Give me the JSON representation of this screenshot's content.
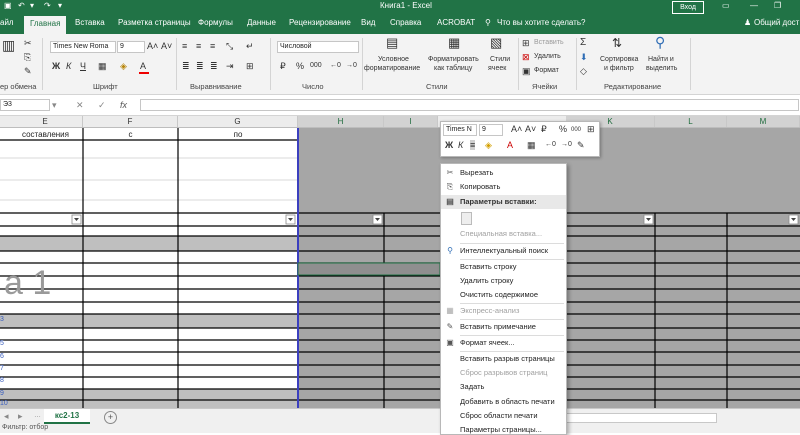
{
  "window": {
    "title": "Книга1  -  Excel",
    "signin_label": "Вход",
    "minimize_glyph": "—",
    "maximize_glyph": "❐"
  },
  "tabs": [
    {
      "label": "айл"
    },
    {
      "label": "Главная"
    },
    {
      "label": "Вставка"
    },
    {
      "label": "Разметка страницы"
    },
    {
      "label": "Формулы"
    },
    {
      "label": "Данные"
    },
    {
      "label": "Рецензирование"
    },
    {
      "label": "Вид"
    },
    {
      "label": "Справка"
    },
    {
      "label": "ACROBAT"
    }
  ],
  "tellme": "Что вы хотите сделать?",
  "share": "Общий дост",
  "ribbon": {
    "font_name": "Times New Roma",
    "font_size": "9",
    "number_format": "Числовой",
    "groups": {
      "clipboard": "ер обмена",
      "font": "Шрифт",
      "alignment": "Выравнивание",
      "number": "Число",
      "styles": "Стили",
      "cells": "Ячейки",
      "editing": "Редактирование"
    },
    "styles_buttons": {
      "conditional": [
        "Условное",
        "форматирование"
      ],
      "as_table": [
        "Форматировать",
        "как таблицу"
      ],
      "cell_styles": [
        "Стили",
        "ячеек"
      ]
    },
    "cells_buttons": {
      "insert": "Вставить",
      "delete": "Удалить",
      "format": "Формат"
    },
    "editing_buttons": {
      "sort": [
        "Сортировка",
        "и фильтр"
      ],
      "find": [
        "Найти и",
        "выделить"
      ]
    },
    "bold": "Ж",
    "italic": "К",
    "underline": "Ч",
    "font_color": "A"
  },
  "formula_bar": {
    "name_box": "Э3",
    "cancel": "✕",
    "enter": "✓",
    "fx": "fx"
  },
  "columns": [
    "E",
    "F",
    "G",
    "H",
    "I",
    "K",
    "L",
    "M"
  ],
  "cells": {
    "e_header": "составления",
    "f_header": "с",
    "g_header": "по",
    "big_text": "а 1"
  },
  "row_numbers": [
    "3",
    "5",
    "6",
    "7",
    "8",
    "9",
    "10",
    "1"
  ],
  "mini_toolbar": {
    "font_name": "Times N",
    "font_size": "9",
    "bold": "Ж",
    "italic": "К",
    "percent": "%",
    "thousands": "000"
  },
  "context_menu": [
    {
      "label": "Вырезать",
      "icon": "scissors-icon",
      "glyph": "✂",
      "state": "normal"
    },
    {
      "label": "Копировать",
      "icon": "copy-icon",
      "glyph": "⎘",
      "state": "normal"
    },
    {
      "label": "Параметры вставки:",
      "icon": "paste-icon",
      "glyph": "▤",
      "state": "header"
    },
    {
      "label": "Специальная вставка...",
      "icon": "",
      "glyph": "",
      "state": "dim"
    },
    {
      "label": "Интеллектуальный поиск",
      "icon": "search-icon",
      "glyph": "⚲",
      "state": "normal"
    },
    {
      "label": "Вставить строку",
      "icon": "",
      "glyph": "",
      "state": "normal"
    },
    {
      "label": "Удалить строку",
      "icon": "",
      "glyph": "",
      "state": "normal"
    },
    {
      "label": "Очистить содержимое",
      "icon": "",
      "glyph": "",
      "state": "normal"
    },
    {
      "label": "Экспресс-анализ",
      "icon": "quick-analysis-icon",
      "glyph": "▦",
      "state": "dim"
    },
    {
      "label": "Вставить примечание",
      "icon": "comment-icon",
      "glyph": "✎",
      "state": "normal"
    },
    {
      "label": "Формат ячеек...",
      "icon": "format-cells-icon",
      "glyph": "▣",
      "state": "normal"
    },
    {
      "label": "Вставить разрыв страницы",
      "icon": "",
      "glyph": "",
      "state": "normal"
    },
    {
      "label": "Сброс разрывов страниц",
      "icon": "",
      "glyph": "",
      "state": "dim"
    },
    {
      "label": "Задать",
      "icon": "",
      "glyph": "",
      "state": "normal"
    },
    {
      "label": "Добавить в область печати",
      "icon": "",
      "glyph": "",
      "state": "normal"
    },
    {
      "label": "Сброс области печати",
      "icon": "",
      "glyph": "",
      "state": "normal"
    },
    {
      "label": "Параметры страницы...",
      "icon": "",
      "glyph": "",
      "state": "normal"
    }
  ],
  "sheet_tab": "кс2-13",
  "add_sheet": "+",
  "status_text": "Фильтр: отбор",
  "colors": {
    "excel_green": "#217346",
    "selection_border": "#3b3fbf",
    "gray_fill": "#a6a6a6"
  }
}
